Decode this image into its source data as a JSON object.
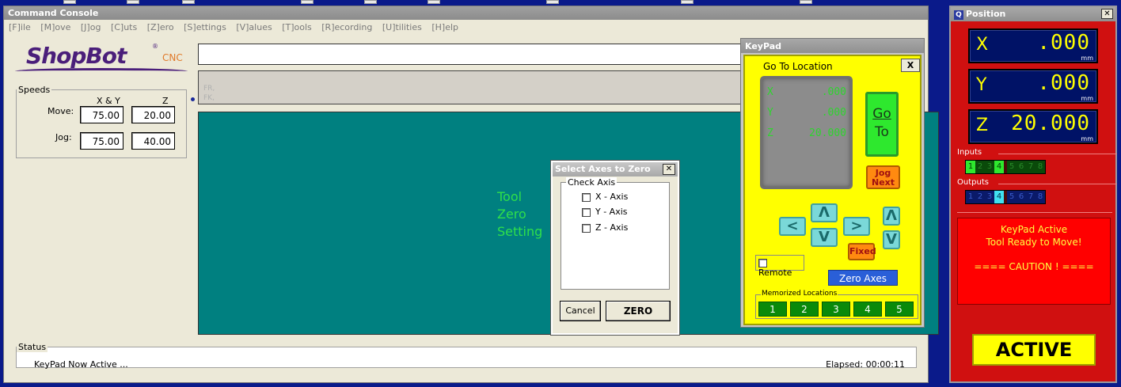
{
  "console": {
    "title": "Command Console",
    "menu": [
      "[F]ile",
      "[M]ove",
      "[J]og",
      "[C]uts",
      "[Z]ero",
      "[S]ettings",
      "[V]alues",
      "[T]ools",
      "[R]ecording",
      "[U]tilities",
      "[H]elp"
    ],
    "logo_text": "ShopBot",
    "logo_reg": "®",
    "logo_cnc": "CNC",
    "speeds": {
      "legend": "Speeds",
      "col_xy": "X & Y",
      "col_z": "Z",
      "move_label": "Move:",
      "jog_label": "Jog:",
      "move_xy": "75.00",
      "move_z": "20.00",
      "jog_xy": "75.00",
      "jog_z": "40.00"
    },
    "ghost_line1": "FR,",
    "ghost_line2": "FK,",
    "tool_zero_lines": [
      "Tool",
      "Zero",
      "Setting"
    ],
    "status": {
      "legend": "Status",
      "message": "KeyPad Now Active ...",
      "elapsed": "Elapsed: 00:00:11"
    }
  },
  "axes_dialog": {
    "title": "Select Axes to Zero",
    "close": "✕",
    "group_label": "Check Axis",
    "options": [
      {
        "label": "X - Axis",
        "checked": false
      },
      {
        "label": "Y - Axis",
        "checked": false
      },
      {
        "label": "Z - Axis",
        "checked": false
      }
    ],
    "cancel": "Cancel",
    "zero": "ZERO"
  },
  "keypad": {
    "title": "KeyPad",
    "goto_label": "Go To Location",
    "close": "X",
    "locations": [
      {
        "axis": "X",
        "value": ".000"
      },
      {
        "axis": "Y",
        "value": ".000"
      },
      {
        "axis": "Z",
        "value": "20.000"
      }
    ],
    "go_line1": "Go",
    "go_line2": "To",
    "jog_line1": "Jog",
    "jog_line2": "Next",
    "arrows": {
      "left": "<",
      "up": "Λ",
      "down": "V",
      "right": ">",
      "z_up": "Λ",
      "z_down": "V"
    },
    "fixed": "Fixed",
    "remote": "Remote",
    "remote_checked": false,
    "zero_axes": "Zero Axes",
    "memorized_label": "Memorized Locations",
    "memorized": [
      "1",
      "2",
      "3",
      "4",
      "5"
    ]
  },
  "position": {
    "title": "Position",
    "close": "✕",
    "icon": "Q",
    "axes": [
      {
        "axis": "X",
        "value": ".000",
        "unit": "mm"
      },
      {
        "axis": "Y",
        "value": ".000",
        "unit": "mm"
      },
      {
        "axis": "Z",
        "value": "20.000",
        "unit": "mm"
      }
    ],
    "inputs_label": "Inputs",
    "inputs": [
      {
        "n": "1",
        "active": true
      },
      {
        "n": "2",
        "active": false
      },
      {
        "n": "3",
        "active": false
      },
      {
        "n": "4",
        "active": true
      },
      {
        "n": "5",
        "active": false
      },
      {
        "n": "6",
        "active": false
      },
      {
        "n": "7",
        "active": false
      },
      {
        "n": "8",
        "active": false
      }
    ],
    "outputs_label": "Outputs",
    "outputs": [
      {
        "n": "1",
        "active": false
      },
      {
        "n": "2",
        "active": false
      },
      {
        "n": "3",
        "active": false
      },
      {
        "n": "4",
        "active": true
      },
      {
        "n": "5",
        "active": false
      },
      {
        "n": "6",
        "active": false
      },
      {
        "n": "7",
        "active": false
      },
      {
        "n": "8",
        "active": false
      }
    ],
    "message_line1": "KeyPad Active",
    "message_line2": "Tool Ready to Move!",
    "message_line3": "==== CAUTION ! ====",
    "active_button": "ACTIVE"
  },
  "colors": {
    "teal": "#008080",
    "keypad_yellow": "#ffff00",
    "position_red": "#d01010",
    "readout_yellow": "#ffff00",
    "led_green": "#2ed42e"
  }
}
